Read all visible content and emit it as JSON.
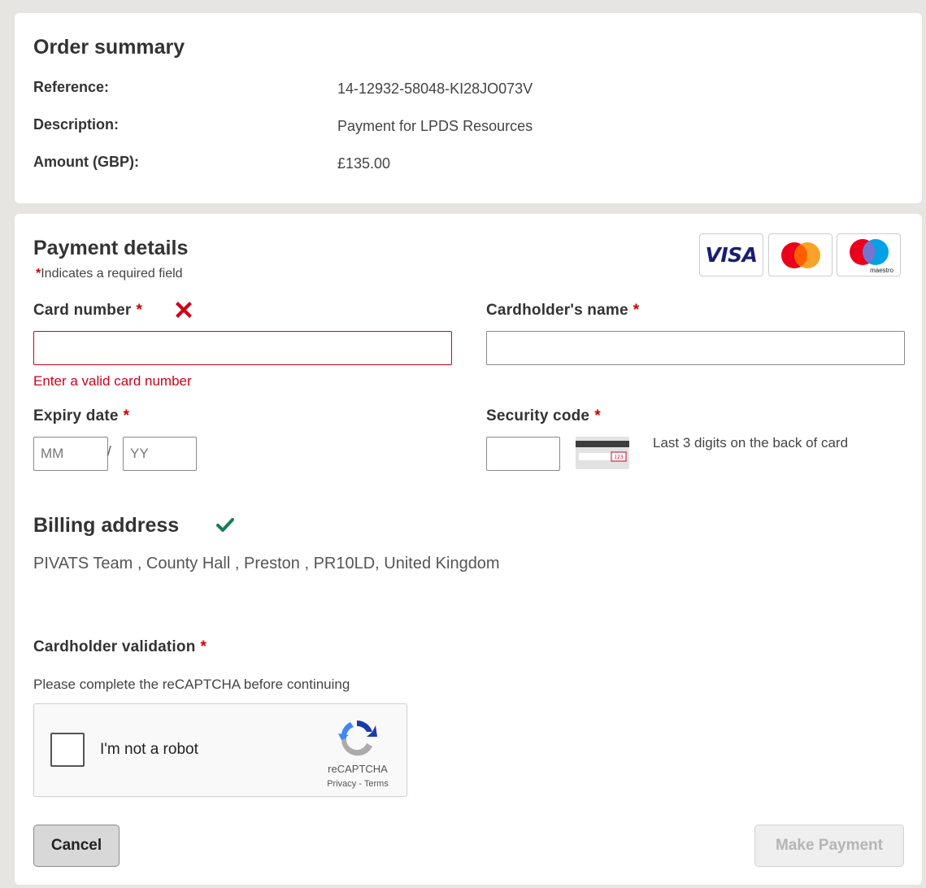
{
  "summary": {
    "title": "Order summary",
    "rows": [
      {
        "label": "Reference:",
        "value": "14-12932-58048-KI28JO073V"
      },
      {
        "label": "Description:",
        "value": "Payment for LPDS Resources"
      },
      {
        "label": "Amount (GBP):",
        "value": "£135.00"
      }
    ]
  },
  "payment": {
    "title": "Payment details",
    "required_star": "*",
    "required_note": "Indicates a required field",
    "card_logos": {
      "visa": "VISA",
      "maestro": "maestro"
    },
    "card_number": {
      "label": "Card number",
      "value": "",
      "error": "Enter a valid card number"
    },
    "cardholder_name": {
      "label": "Cardholder's name",
      "value": ""
    },
    "expiry": {
      "label": "Expiry date",
      "month_placeholder": "MM",
      "separator": "/",
      "year_placeholder": "YY"
    },
    "security_code": {
      "label": "Security code",
      "value": "",
      "hint": "Last 3 digits on the back of card",
      "icon_digits": "123"
    }
  },
  "billing": {
    "title": "Billing address",
    "address": "PIVATS Team , County Hall , Preston , PR10LD, United Kingdom"
  },
  "validation": {
    "label": "Cardholder validation",
    "note": "Please complete the reCAPTCHA before continuing",
    "captcha_label": "I'm not a robot",
    "captcha_brand": "reCAPTCHA",
    "captcha_links": "Privacy - Terms"
  },
  "buttons": {
    "cancel": "Cancel",
    "pay": "Make Payment"
  },
  "colors": {
    "error": "#d0021b",
    "success": "#1a7a5a",
    "required": "#cc0000",
    "background": "#e6e5e1"
  }
}
